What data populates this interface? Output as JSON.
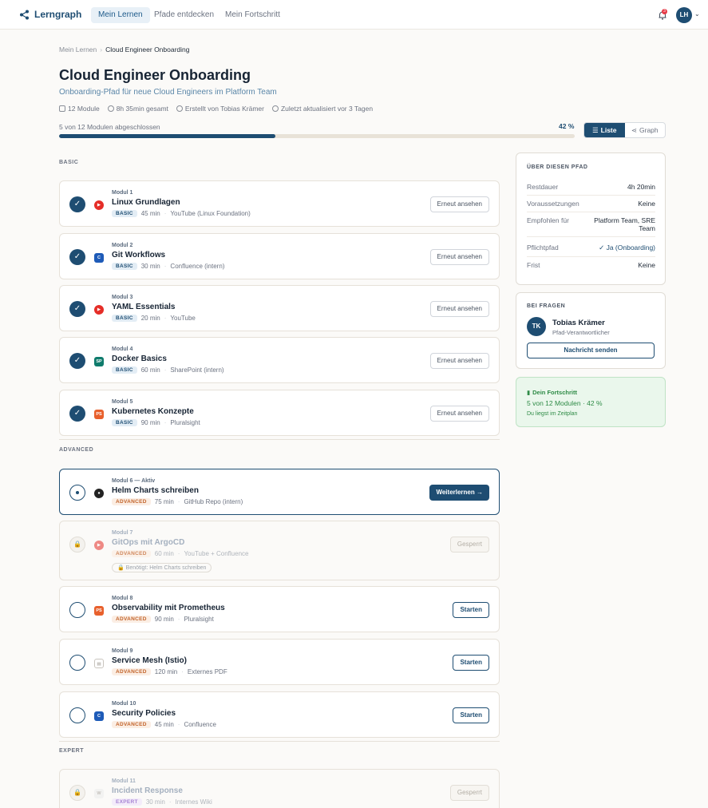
{
  "nav": {
    "logo": "Lerngraph",
    "links": [
      "Mein Lernen",
      "Pfade entdecken",
      "Mein Fortschritt"
    ],
    "notification_count": "3",
    "avatar": "LH"
  },
  "breadcrumb": {
    "parent": "Mein Lernen",
    "sep": "›",
    "current": "Cloud Engineer Onboarding"
  },
  "header": {
    "title": "Cloud Engineer Onboarding",
    "subtitle": "Onboarding-Pfad für neue Cloud Engineers im Platform Team",
    "meta": [
      "12 Module",
      "8h 35min gesamt",
      "Erstellt von Tobias Krämer",
      "Zuletzt aktualisiert vor 3 Tagen"
    ]
  },
  "progress": {
    "label": "5 von 12 Modulen abgeschlossen",
    "percent_label": "42 %",
    "fraction": 0.42
  },
  "view_toggle": {
    "list": "Liste",
    "graph": "Graph",
    "list_icon": "☰",
    "graph_icon": "⋖"
  },
  "sections": {
    "basic": "BASIC",
    "advanced": "ADVANCED",
    "expert": "EXPERT"
  },
  "modules": [
    {
      "num": "Modul 1",
      "title": "Linux Grundlagen",
      "level": "BASIC",
      "duration": "45 min",
      "source": "YouTube (Linux Foundation)",
      "src_icon": "youtube-icon",
      "src_glyph": "▶",
      "button": "Erneut ansehen",
      "status": "done"
    },
    {
      "num": "Modul 2",
      "title": "Git Workflows",
      "level": "BASIC",
      "duration": "30 min",
      "source": "Confluence (intern)",
      "src_icon": "confluence-icon",
      "src_glyph": "C",
      "button": "Erneut ansehen",
      "status": "done"
    },
    {
      "num": "Modul 3",
      "title": "YAML Essentials",
      "level": "BASIC",
      "duration": "20 min",
      "source": "YouTube",
      "src_icon": "youtube-icon",
      "src_glyph": "▶",
      "button": "Erneut ansehen",
      "status": "done"
    },
    {
      "num": "Modul 4",
      "title": "Docker Basics",
      "level": "BASIC",
      "duration": "60 min",
      "source": "SharePoint (intern)",
      "src_icon": "sharepoint-icon",
      "src_glyph": "SP",
      "button": "Erneut ansehen",
      "status": "done"
    },
    {
      "num": "Modul 5",
      "title": "Kubernetes Konzepte",
      "level": "BASIC",
      "duration": "90 min",
      "source": "Pluralsight",
      "src_icon": "pluralsight-icon",
      "src_glyph": "PS",
      "button": "Erneut ansehen",
      "status": "done"
    },
    {
      "num": "Modul 6 — Aktiv",
      "title": "Helm Charts schreiben",
      "level": "ADVANCED",
      "duration": "75 min",
      "source": "GitHub Repo (intern)",
      "src_icon": "github-icon",
      "src_glyph": "●",
      "button": "Weiterlernen →",
      "status": "current"
    },
    {
      "num": "Modul 7",
      "title": "GitOps mit ArgoCD",
      "level": "ADVANCED",
      "duration": "60 min",
      "source": "YouTube + Confluence",
      "src_icon": "youtube-icon",
      "src_glyph": "▶",
      "button": "Gesperrt",
      "status": "locked",
      "prereq": "🔒 Benötigt: Helm Charts schreiben"
    },
    {
      "num": "Modul 8",
      "title": "Observability mit Prometheus",
      "level": "ADVANCED",
      "duration": "90 min",
      "source": "Pluralsight",
      "src_icon": "pluralsight-icon",
      "src_glyph": "PS",
      "button": "Starten",
      "status": "open"
    },
    {
      "num": "Modul 9",
      "title": "Service Mesh (Istio)",
      "level": "ADVANCED",
      "duration": "120 min",
      "source": "Externes PDF",
      "src_icon": "pdf-icon",
      "src_glyph": "▤",
      "button": "Starten",
      "status": "open"
    },
    {
      "num": "Modul 10",
      "title": "Security Policies",
      "level": "ADVANCED",
      "duration": "45 min",
      "source": "Confluence",
      "src_icon": "confluence-icon",
      "src_glyph": "C",
      "button": "Starten",
      "status": "open"
    },
    {
      "num": "Modul 11",
      "title": "Incident Response",
      "level": "EXPERT",
      "duration": "30 min",
      "source": "Internes Wiki",
      "src_icon": "wiki-icon",
      "src_glyph": "W",
      "button": "Gesperrt",
      "status": "locked"
    }
  ],
  "about": {
    "title": "ÜBER DIESEN PFAD",
    "rows": [
      {
        "k": "Restdauer",
        "v": "4h 20min"
      },
      {
        "k": "Voraussetzungen",
        "v": "Keine"
      },
      {
        "k": "Empfohlen für",
        "v": "Platform Team, SRE Team"
      },
      {
        "k": "Pflichtpfad",
        "v": "✓ Ja (Onboarding)"
      },
      {
        "k": "Frist",
        "v": "Keine"
      }
    ]
  },
  "contact": {
    "title": "BEI FRAGEN",
    "initials": "TK",
    "name": "Tobias Krämer",
    "role": "Pfad-Verantwortlicher",
    "button": "Nachricht senden"
  },
  "my_progress": {
    "title": "Dein Fortschritt",
    "line": "5 von 12 Modulen · 42 %",
    "sub": "Du liegst im Zeitplan"
  }
}
